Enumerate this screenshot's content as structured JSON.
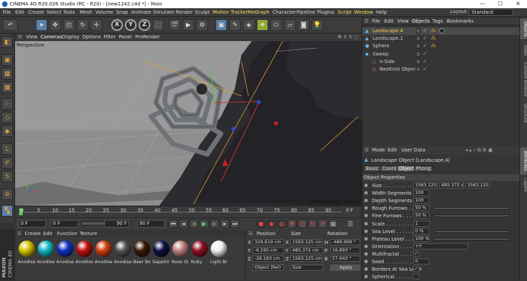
{
  "window": {
    "title": "CINEMA 4D R20.026 Studio (RC - R20) - [new1242.c4d *] - Main",
    "min": "—",
    "max": "☐",
    "close": "✕"
  },
  "menu": [
    "File",
    "Edit",
    "Create",
    "Select",
    "Tools",
    "Mesh",
    "Volume",
    "Snap",
    "Animate",
    "Simulate",
    "Render",
    "Sculpt",
    "Motion Tracker",
    "MoGraph",
    "Character",
    "Pipeline",
    "Plugins",
    "Script",
    "Window",
    "Help"
  ],
  "layout": {
    "label": "Layout:",
    "value": "Standard"
  },
  "viewport": {
    "menu": [
      "View",
      "Cameras",
      "Display",
      "Options",
      "Filter",
      "Panel",
      "ProRender"
    ],
    "camera": "Perspective",
    "grid_spacing": "Grid Spacing : 100 cm"
  },
  "timeline": {
    "ticks": [
      "0",
      "5",
      "10",
      "15",
      "20",
      "25",
      "30",
      "35",
      "40",
      "45",
      "50",
      "55",
      "60",
      "65",
      "70",
      "75",
      "80",
      "85",
      "90"
    ],
    "end_label": "0 F"
  },
  "timecontrols": {
    "start": "0 F",
    "min": "0 F",
    "end_field": "90 F",
    "max": "90 F"
  },
  "materials": {
    "menu": [
      "Create",
      "Edit",
      "Function",
      "Texture"
    ],
    "items": [
      {
        "label": "Anodise",
        "color": "#d4c100"
      },
      {
        "label": "Anodise",
        "color": "#12b6c0"
      },
      {
        "label": "Anodise",
        "color": "#1030c0"
      },
      {
        "label": "Anodise",
        "color": "#c01010"
      },
      {
        "label": "Anodise",
        "color": "#d04010"
      },
      {
        "label": "Anodise",
        "color": "#555555"
      },
      {
        "label": "Beer Bo",
        "color": "#3a1a08"
      },
      {
        "label": "Sapphir",
        "color": "#101040"
      },
      {
        "label": "Rose Gl",
        "color": "#c08080"
      },
      {
        "label": "Ruby",
        "color": "#901020"
      },
      {
        "label": "Light Br",
        "color": "#f0f0f0"
      }
    ]
  },
  "brand": {
    "line1": "MAXON",
    "line2": "CINEMA 4D"
  },
  "coords": {
    "headers": [
      "Position",
      "Size",
      "Rotation"
    ],
    "rows": [
      {
        "axis": "X",
        "pos": "329.619 cm",
        "size_axis": "X",
        "size": "1563.125 cm",
        "rot_axis": "H",
        "rot": "-486.999 °"
      },
      {
        "axis": "Y",
        "pos": "-6.195 cm",
        "size_axis": "Y",
        "size": "485.372 cm",
        "rot_axis": "P",
        "rot": "16.893 °"
      },
      {
        "axis": "Z",
        "pos": "-26.183 cm",
        "size_axis": "Z",
        "size": "1563.125 cm",
        "rot_axis": "B",
        "rot": "57.043 °"
      }
    ],
    "mode": "Object (Rel)",
    "size_mode": "Size",
    "apply": "Apply"
  },
  "objects": {
    "tabs": [
      "File",
      "Edit",
      "View",
      "Objects",
      "Tags",
      "Bookmarks"
    ],
    "rows": [
      {
        "name": "Landscape.4",
        "selected": true,
        "indent": 0
      },
      {
        "name": "Landscape.1",
        "selected": false,
        "indent": 0
      },
      {
        "name": "Sphere",
        "selected": false,
        "indent": 0
      },
      {
        "name": "Sweep",
        "selected": false,
        "indent": 0
      },
      {
        "name": "n-Side",
        "selected": false,
        "indent": 1
      },
      {
        "name": "NeoKnot Object",
        "selected": false,
        "indent": 1
      }
    ]
  },
  "attributes": {
    "menu": [
      "Mode",
      "Edit",
      "User Data"
    ],
    "title": "Landscape Object [Landscape.4]",
    "tabs": [
      "Basic",
      "Coord.",
      "Object",
      "Phong"
    ],
    "section": "Object Properties",
    "rows": [
      {
        "label": "Size . . . . . . . . . . . .",
        "values": [
          "1563.125 c",
          "485.372 c",
          "1563.125"
        ]
      },
      {
        "label": "Width Segments . . .",
        "values": [
          "100"
        ]
      },
      {
        "label": "Depth Segments . . .",
        "values": [
          "100"
        ]
      },
      {
        "label": "Rough Furrows . . .",
        "values": [
          "50 %"
        ]
      },
      {
        "label": "Fine Furrows . . . .",
        "values": [
          "50 %"
        ]
      },
      {
        "label": "Scale . . . . . . . . . .",
        "values": [
          "1"
        ]
      },
      {
        "label": "Sea Level . . . . . . .",
        "values": [
          "0 %"
        ]
      },
      {
        "label": "Plateau Level . . . .",
        "values": [
          "100 %"
        ]
      },
      {
        "label": "Orientation . . . . . .",
        "values": [
          "+Y"
        ]
      },
      {
        "label": "Multifractal . . . . .",
        "values": [
          "✓"
        ]
      },
      {
        "label": "Seed . . . . . . . . . .",
        "values": [
          "0"
        ]
      },
      {
        "label": "Borders At Sea Level",
        "values": [
          "✓"
        ]
      },
      {
        "label": "Spherical . . . . . . .",
        "values": [
          ""
        ]
      }
    ]
  },
  "right_tabs": [
    "Objects",
    "Takes",
    "Content Browser",
    "Structure",
    "Attributes",
    "Layers"
  ]
}
